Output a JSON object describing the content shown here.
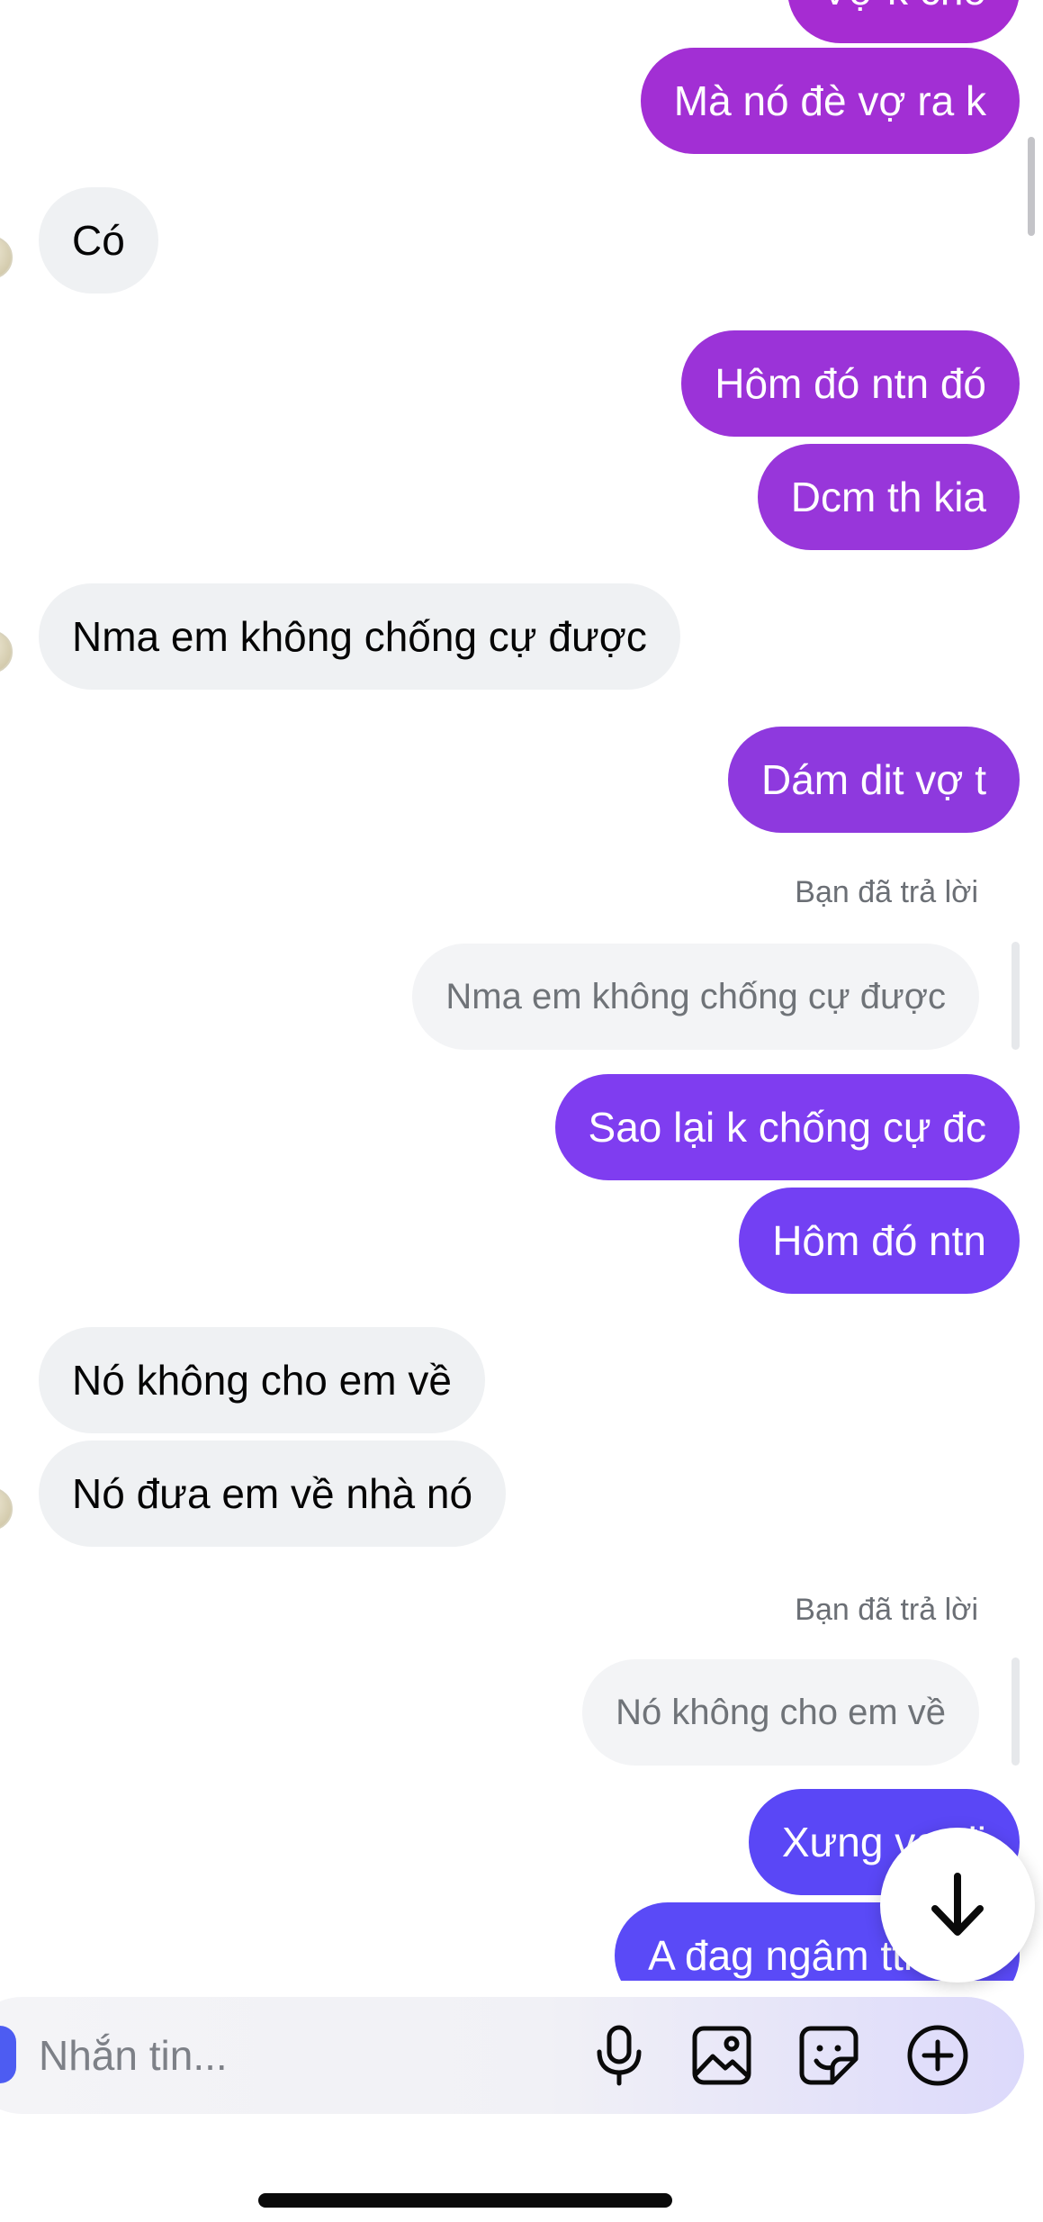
{
  "messages": {
    "m0": "Vợ k cho",
    "m1": "Mà nó đè vợ ra k",
    "m2": "Có",
    "m3": "Hôm đó ntn đó",
    "m4": "Dcm th kia",
    "m5": "Nma em không chống cự được",
    "m6": "Dám dit vợ t",
    "m7": "Sao lại k chống cự đc",
    "m8": "Hôm đó ntn",
    "m9": "Nó không cho em về",
    "m10": "Nó đưa em về nhà nó",
    "m11": "Xưng vợ đi",
    "m12": "A đag ngâm ttrung"
  },
  "replies": {
    "r1": {
      "note": "Bạn đã trả lời",
      "quoted": "Nma em không chống cự được"
    },
    "r2": {
      "note": "Bạn đã trả lời",
      "quoted": "Nó không cho em về"
    }
  },
  "composer": {
    "placeholder": "Nhắn tin...",
    "icons": [
      "microphone-icon",
      "image-icon",
      "sticker-icon",
      "plus-circle-icon"
    ]
  },
  "colors": {
    "outgoing_gradient": [
      "#a22fd4",
      "#5a4af7"
    ],
    "incoming_bubble": "#eff1f3",
    "accent": "#4d5cf2"
  }
}
